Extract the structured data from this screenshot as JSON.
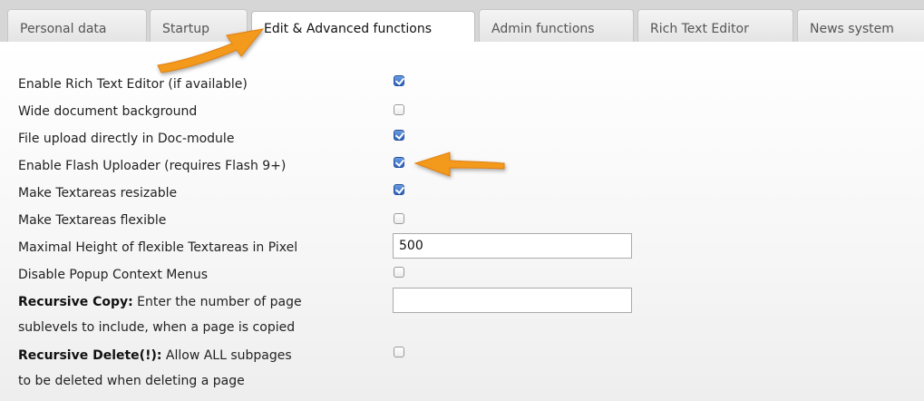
{
  "tabs": [
    {
      "label": "Personal data",
      "active": false
    },
    {
      "label": "Startup",
      "active": false
    },
    {
      "label": "Edit & Advanced functions",
      "active": true
    },
    {
      "label": "Admin functions",
      "active": false
    },
    {
      "label": "Rich Text Editor",
      "active": false
    },
    {
      "label": "News system",
      "active": false
    }
  ],
  "settings": {
    "rich_text_editor": {
      "label": "Enable Rich Text Editor (if available)",
      "checked": true
    },
    "wide_background": {
      "label": "Wide document background",
      "checked": false
    },
    "file_upload": {
      "label": "File upload directly in Doc-module",
      "checked": true
    },
    "flash_uploader": {
      "label": "Enable Flash Uploader (requires Flash 9+)",
      "checked": true
    },
    "textareas_resizable": {
      "label": "Make Textareas resizable",
      "checked": true
    },
    "textareas_flexible": {
      "label": "Make Textareas flexible",
      "checked": false
    },
    "max_height": {
      "label": "Maximal Height of flexible Textareas in Pixel",
      "value": "500"
    },
    "disable_popup": {
      "label": "Disable Popup Context Menus",
      "checked": false
    },
    "recursive_copy": {
      "bold": "Recursive Copy:",
      "text": " Enter the number of page",
      "line2": "sublevels to include, when a page is copied",
      "value": ""
    },
    "recursive_delete": {
      "bold": "Recursive Delete(!):",
      "text": " Allow ALL subpages",
      "line2": "to be deleted when deleting a page",
      "checked": false
    }
  },
  "colors": {
    "arrow": "#f39a1e",
    "checkbox_checked": "#2d64be"
  }
}
